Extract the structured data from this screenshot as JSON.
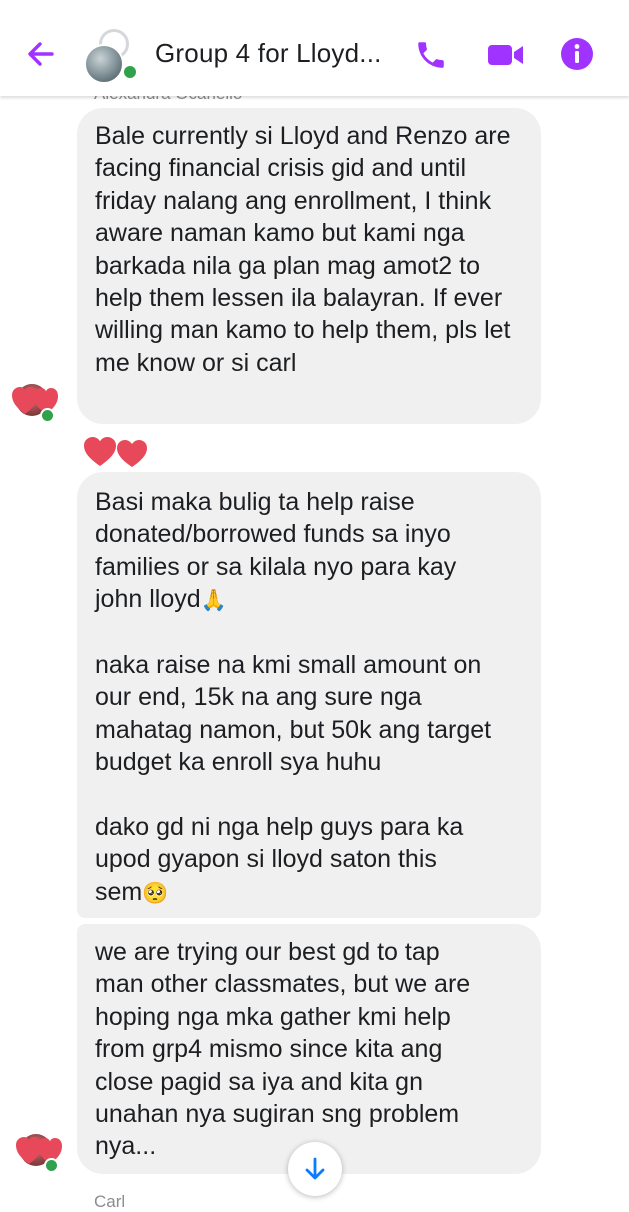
{
  "header": {
    "title": "Group 4 for Lloyd...",
    "accent_color": "#a033ff",
    "icons": [
      "back-arrow-icon",
      "phone-icon",
      "video-camera-icon",
      "info-icon"
    ]
  },
  "messages": [
    {
      "sender": "Alexandra Ocanello",
      "text": "Bale currently si Lloyd and Renzo are facing financial crisis gid and until friday nalang ang enrollment, I think aware naman kamo but kami nga barkada nila ga plan mag amot2 to help them lessen ila balayran. If ever willing man kamo to help them, pls let me know or si carl"
    },
    {
      "text_lines": [
        "Basi maka bulig ta help raise",
        "donated/borrowed funds sa inyo",
        "families or sa kilala nyo para kay",
        "john lloyd",
        "",
        "naka raise na kmi small amount on",
        "our end, 15k na ang sure nga",
        "mahatag namon, but 50k ang target",
        "budget ka enroll sya huhu",
        "",
        "dako gd ni nga help guys para ka",
        "upod gyapon si lloyd saton this",
        "sem"
      ],
      "emoji_after_line_4": "🙏",
      "emoji_after_last_line": "🥺"
    },
    {
      "text_lines": [
        "we are trying our best gd to tap",
        "man other classmates, but we are",
        "hoping nga mka gather kmi help",
        "from grp4 mismo since kita ang",
        "close pagid sa iya and kita gn",
        "unahan nya sugiran sng problem",
        "nya..."
      ]
    }
  ],
  "footer_sender": "Carl",
  "colors": {
    "bubble": "#f0f0f0",
    "online_dot": "#31a24c",
    "heart": "#e8495a"
  }
}
